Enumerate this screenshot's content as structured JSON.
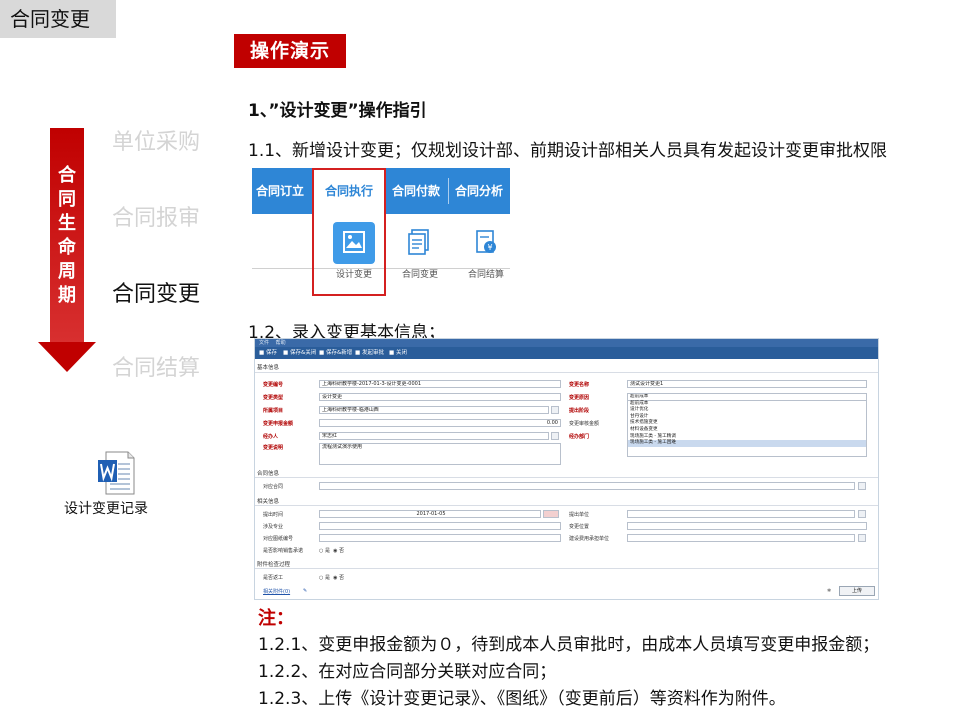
{
  "header": {
    "title": "合同变更",
    "tag": "操作演示"
  },
  "lifecycle": {
    "arrow_text": [
      "合",
      "同",
      "生",
      "命",
      "周",
      "期"
    ],
    "stages": [
      "单位采购",
      "合同报审",
      "合同变更",
      "合同结算"
    ],
    "active_stage": "合同变更"
  },
  "attachment": {
    "caption": "设计变更记录",
    "icon": "word-doc-icon"
  },
  "content": {
    "heading": "1、”设计变更”操作指引",
    "step1": "1.1、新增设计变更；仅规划设计部、前期设计部相关人员具有发起设计变更审批权限",
    "step2": "1.2、录入变更基本信息；",
    "note_title": "注：",
    "notes": [
      "1.2.1、变更申报金额为０，待到成本人员审批时，由成本人员填写变更申报金额；",
      "1.2.2、在对应合同部分关联对应合同；",
      "1.2.3、上传《设计变更记录》、《图纸》（变更前后）等资料作为附件。"
    ]
  },
  "nav_screenshot": {
    "tabs": [
      "合同订立",
      "合同执行",
      "合同付款",
      "合同分析"
    ],
    "selected_tab": "合同执行",
    "sub_items": [
      "设计变更",
      "合同变更",
      "合同结算"
    ],
    "colors": {
      "bar": "#2e86d6",
      "highlight": "#d42020"
    }
  },
  "form_screenshot": {
    "menu": [
      "文件",
      "帮助"
    ],
    "toolbar": [
      "保存",
      "保存&关闭",
      "保存&新增",
      "发起审批",
      "关闭"
    ],
    "sections": {
      "basic": "基本信息",
      "contract": "合同信息",
      "related": "相关信息",
      "attach": "附件检查过程"
    },
    "fields": {
      "change_no": {
        "label": "变更编号",
        "value": "上海科研教学楼-2017-01-3-设计变更-0001"
      },
      "change_name": {
        "label": "变更名称",
        "value": "测试设计变更1"
      },
      "change_type": {
        "label": "变更类型",
        "value": "设计变更"
      },
      "change_reason": {
        "label": "变更原因",
        "value": "超前成本"
      },
      "project": {
        "label": "所属项目",
        "value": "上海科研教学楼-临港山西"
      },
      "change_stage": {
        "label": "提出阶段"
      },
      "amount": {
        "label": "变更申报金额",
        "value": "0.00"
      },
      "review_amount": {
        "label": "变更审核金额"
      },
      "handler": {
        "label": "经办人",
        "value": "宋志红"
      },
      "dept": {
        "label": "经办部门"
      },
      "desc": {
        "label": "变更说明",
        "value": "流程测试演示使用"
      },
      "contract": {
        "label": "对应合同"
      },
      "date": {
        "label": "提出时间",
        "value": "2017-01-05"
      },
      "proposer": {
        "label": "提出单位"
      },
      "major": {
        "label": "涉及专业"
      },
      "location": {
        "label": "变更位置"
      },
      "drawing_no": {
        "label": "对应图纸编号"
      },
      "cost_unit": {
        "label": "建设费用承担单位"
      },
      "affects": {
        "label": "是否影响销售承诺",
        "options": [
          "是",
          "否"
        ],
        "selected": "否"
      },
      "rectify": {
        "label": "是否返工",
        "options": [
          "是",
          "否"
        ],
        "selected": "否"
      },
      "attachments": {
        "label": "相关附件(0)",
        "upload_label": "上传"
      }
    },
    "reason_options": [
      "超前成本",
      "设计优化",
      "甘丹设计",
      "技术措施变更",
      "材料设备变更",
      "现场施工类 - 施工精调",
      "现场施工类 - 施工困难"
    ],
    "reason_highlighted": "现场施工类 - 施工困难"
  }
}
